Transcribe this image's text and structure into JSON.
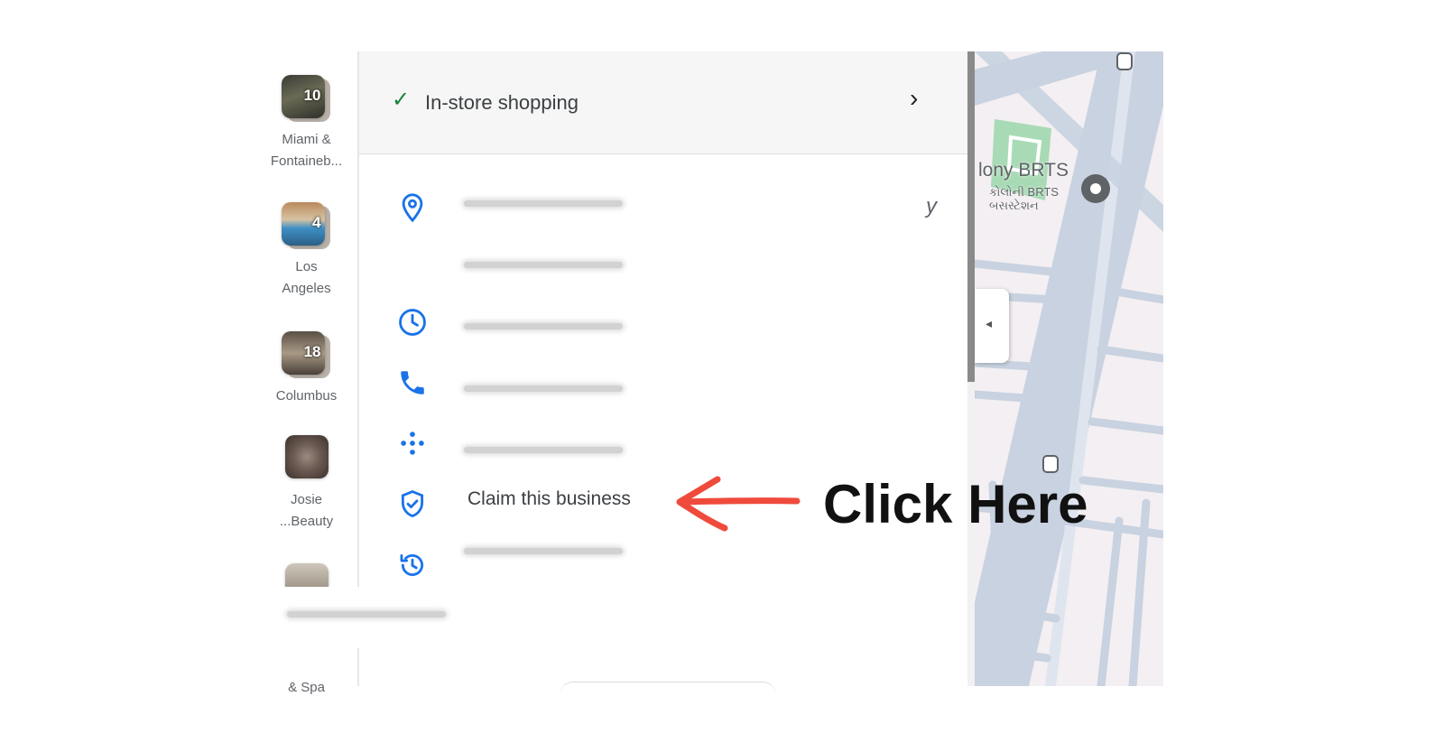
{
  "rail": {
    "items": [
      {
        "label_lines": [
          "Miami &",
          "Fontaineb..."
        ],
        "count": "10"
      },
      {
        "label_lines": [
          "Los",
          "Angeles"
        ],
        "count": "4"
      },
      {
        "label_lines": [
          "Columbus"
        ],
        "count": "18"
      },
      {
        "label_lines": [
          "Josie",
          "...Beauty"
        ],
        "count": ""
      },
      {
        "label_lines": [
          "& Spa"
        ],
        "count": ""
      }
    ]
  },
  "panel": {
    "top_row": {
      "label": "In-store shopping"
    },
    "claim": {
      "label": "Claim this business"
    },
    "stray_text": "y",
    "icons": [
      "location-pin-icon",
      "clock-icon",
      "phone-icon",
      "plus-code-icon",
      "verified-shield-icon",
      "history-icon"
    ]
  },
  "map": {
    "station_label": "lony BRTS",
    "station_label_local": [
      "કોલોની BRTS",
      "બસસ્ટેશન"
    ],
    "collapse_glyph": "◂"
  },
  "annotation": {
    "text": "Click Here",
    "arrow_color": "#ef4a3c"
  },
  "colors": {
    "accent_blue": "#1a73e8",
    "check_green": "#188038",
    "map_road": "#c8d2e0",
    "map_park": "#a8dab5"
  }
}
